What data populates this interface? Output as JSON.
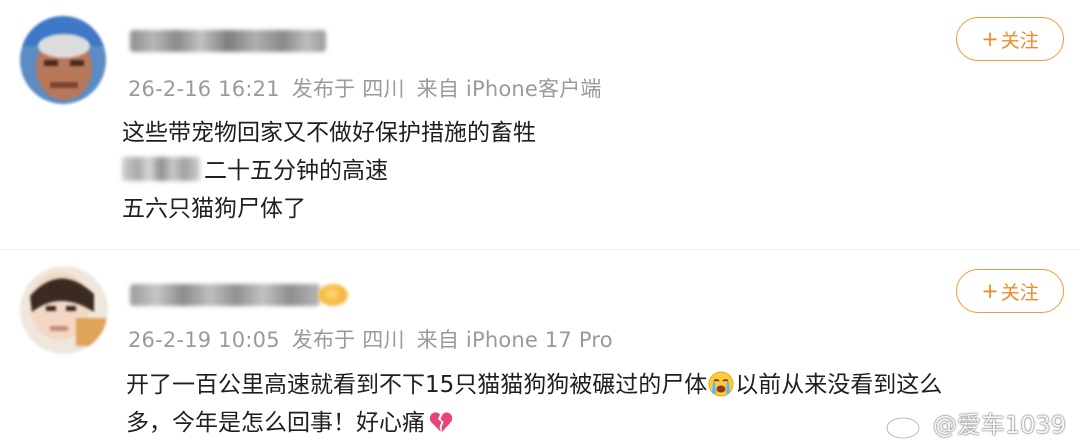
{
  "comments": [
    {
      "date": "26-2-16 16:21",
      "location_label": "发布于 四川",
      "source_label": "来自 iPhone客户端",
      "follow_label": "关注",
      "lines": [
        "这些带宠物回家又不做好保护措施的畜牲",
        "二十五分钟的高速",
        "五六只猫狗尸体了"
      ]
    },
    {
      "date": "26-2-19 10:05",
      "location_label": "发布于 四川",
      "source_label": "来自 iPhone 17 Pro",
      "follow_label": "关注",
      "text_part1": "开了一百公里高速就看到不下15只猫猫狗狗被碾过的尸体",
      "text_part2": "以前从来没看到这么",
      "text_part3": "多，今年是怎么回事！好心痛",
      "emoji_1": "loudly-crying-face",
      "emoji_2": "broken-heart"
    }
  ],
  "watermark": {
    "text": "@爱车1039",
    "icon": "weibo-logo-icon"
  },
  "colors": {
    "accent": "#f08a24",
    "meta_text": "#9a9a9a",
    "body_text": "#1f1f1f"
  }
}
